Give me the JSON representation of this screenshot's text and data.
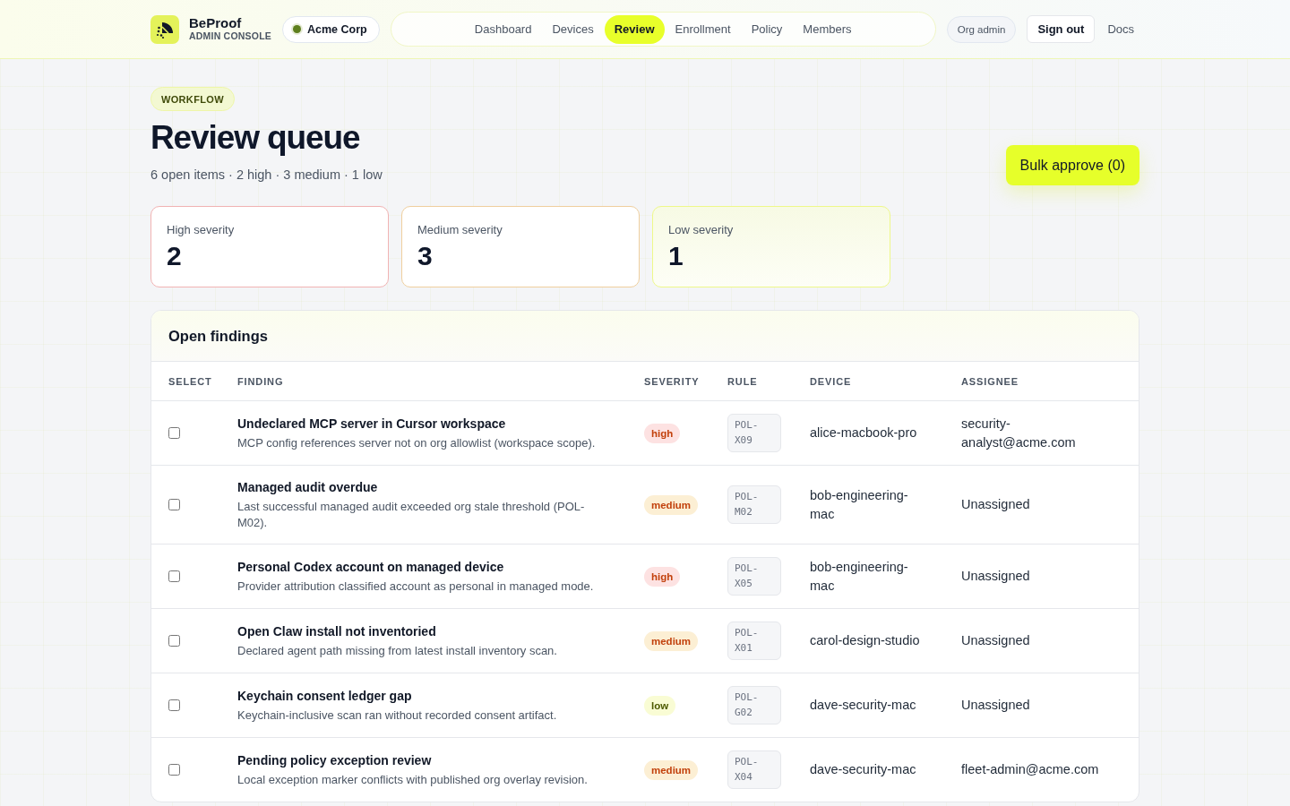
{
  "header": {
    "brand": {
      "name": "BeProof",
      "subtitle": "ADMIN CONSOLE"
    },
    "org": {
      "name": "Acme Corp"
    },
    "nav": [
      {
        "label": "Dashboard",
        "selected": false
      },
      {
        "label": "Devices",
        "selected": false
      },
      {
        "label": "Review",
        "selected": true
      },
      {
        "label": "Enrollment",
        "selected": false
      },
      {
        "label": "Policy",
        "selected": false
      },
      {
        "label": "Members",
        "selected": false
      }
    ],
    "role": "Org admin",
    "sign_out": "Sign out",
    "docs": "Docs"
  },
  "page": {
    "eyebrow": "WORKFLOW",
    "title": "Review queue",
    "summary": "6 open items · 2 high · 3 medium · 1 low",
    "bulk_action": "Bulk approve (0)"
  },
  "stats": [
    {
      "kind": "high",
      "label": "High severity",
      "value": "2"
    },
    {
      "kind": "medium",
      "label": "Medium severity",
      "value": "3"
    },
    {
      "kind": "low",
      "label": "Low severity",
      "value": "1"
    }
  ],
  "findings": {
    "title": "Open findings",
    "columns": [
      "SELECT",
      "FINDING",
      "SEVERITY",
      "RULE",
      "DEVICE",
      "ASSIGNEE"
    ],
    "rows": [
      {
        "checked": false,
        "title": "Undeclared MCP server in Cursor workspace",
        "description": "MCP config references server not on org allowlist (workspace scope).",
        "severity": {
          "kind": "high",
          "label": "high"
        },
        "rule": "POL-X09",
        "device": "alice-macbook-pro",
        "assignee": "security-analyst@acme.com"
      },
      {
        "checked": false,
        "title": "Managed audit overdue",
        "description": "Last successful managed audit exceeded org stale threshold (POL-M02).",
        "severity": {
          "kind": "medium",
          "label": "medium"
        },
        "rule": "POL-M02",
        "device": "bob-engineering-mac",
        "assignee": "Unassigned"
      },
      {
        "checked": false,
        "title": "Personal Codex account on managed device",
        "description": "Provider attribution classified account as personal in managed mode.",
        "severity": {
          "kind": "high",
          "label": "high"
        },
        "rule": "POL-X05",
        "device": "bob-engineering-mac",
        "assignee": "Unassigned"
      },
      {
        "checked": false,
        "title": "Open Claw install not inventoried",
        "description": "Declared agent path missing from latest install inventory scan.",
        "severity": {
          "kind": "medium",
          "label": "medium"
        },
        "rule": "POL-X01",
        "device": "carol-design-studio",
        "assignee": "Unassigned"
      },
      {
        "checked": false,
        "title": "Keychain consent ledger gap",
        "description": "Keychain-inclusive scan ran without recorded consent artifact.",
        "severity": {
          "kind": "low",
          "label": "low"
        },
        "rule": "POL-G02",
        "device": "dave-security-mac",
        "assignee": "Unassigned"
      },
      {
        "checked": false,
        "title": "Pending policy exception review",
        "description": "Local exception marker conflicts with published org overlay revision.",
        "severity": {
          "kind": "medium",
          "label": "medium"
        },
        "rule": "POL-X04",
        "device": "dave-security-mac",
        "assignee": "fleet-admin@acme.com"
      }
    ]
  }
}
